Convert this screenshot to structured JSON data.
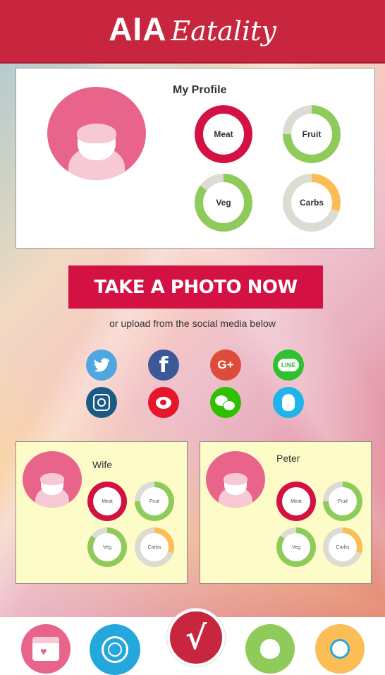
{
  "header": {
    "brand": "AIA",
    "app_name": "Eatality"
  },
  "profile": {
    "title": "My Profile",
    "rings": [
      {
        "label": "Meat",
        "fill": 1.0,
        "color": "#d31142"
      },
      {
        "label": "Fruit",
        "fill": 0.75,
        "color": "#8fcb5a"
      },
      {
        "label": "Veg",
        "fill": 0.85,
        "color": "#8fcb5a"
      },
      {
        "label": "Carbs",
        "fill": 0.3,
        "color": "#fbbe56"
      }
    ]
  },
  "cta": {
    "label": "TAKE A PHOTO NOW"
  },
  "upload_text": "or upload from the social media below",
  "social": [
    {
      "name": "twitter",
      "color": "#4ea7df",
      "glyph": "🐦"
    },
    {
      "name": "facebook",
      "color": "#3b5998",
      "glyph": "f"
    },
    {
      "name": "google-plus",
      "color": "#dd4b39",
      "glyph": "G+"
    },
    {
      "name": "line",
      "color": "#2fc12f",
      "glyph": "LINE"
    },
    {
      "name": "instagram",
      "color": "#1a5a85",
      "glyph": "◎"
    },
    {
      "name": "weibo",
      "color": "#e6162d",
      "glyph": "微"
    },
    {
      "name": "wechat",
      "color": "#2dc100",
      "glyph": "💬"
    },
    {
      "name": "qq",
      "color": "#1fb4ea",
      "glyph": "Q"
    }
  ],
  "family": [
    {
      "name": "Wife",
      "rings": [
        {
          "label": "Meat",
          "fill": 1.0,
          "color": "#d31142"
        },
        {
          "label": "Fruit",
          "fill": 0.75,
          "color": "#8fcb5a"
        },
        {
          "label": "Veg",
          "fill": 0.85,
          "color": "#8fcb5a"
        },
        {
          "label": "Carbs",
          "fill": 0.3,
          "color": "#fbbe56"
        }
      ]
    },
    {
      "name": "Peter",
      "rings": [
        {
          "label": "Meat",
          "fill": 1.0,
          "color": "#d31142"
        },
        {
          "label": "Fruit",
          "fill": 0.75,
          "color": "#8fcb5a"
        },
        {
          "label": "Veg",
          "fill": 0.85,
          "color": "#8fcb5a"
        },
        {
          "label": "Carbs",
          "fill": 0.3,
          "color": "#fbbe56"
        }
      ]
    }
  ],
  "nav": [
    {
      "name": "calendar-heart",
      "color": "#e9648a"
    },
    {
      "name": "award-ribbon",
      "color": "#24a7dd"
    },
    {
      "name": "check-home",
      "color": "#c8263f"
    },
    {
      "name": "apple",
      "color": "#8fcb5a"
    },
    {
      "name": "family-search",
      "color": "#fbbe56"
    }
  ]
}
